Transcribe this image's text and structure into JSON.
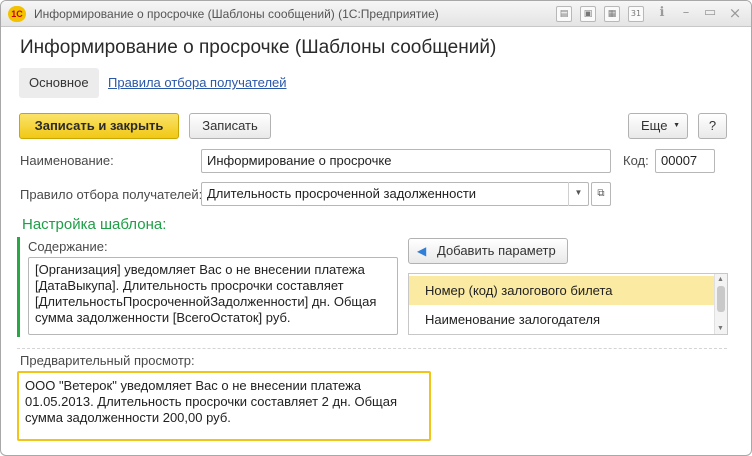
{
  "window": {
    "title": "Информирование о просрочке (Шаблоны сообщений)  (1С:Предприятие)",
    "logo": "1С",
    "icons": [
      "print-icon",
      "save-icon",
      "calendar-icon",
      "calendar31-icon",
      "text-icon",
      "minimize-icon",
      "maximize-icon",
      "close-icon"
    ],
    "calendar_day": "31"
  },
  "form": {
    "title": "Информирование о просрочке (Шаблоны сообщений)",
    "tabs": [
      {
        "label": "Основное"
      },
      {
        "label": "Правила отбора получателей"
      }
    ]
  },
  "toolbar": {
    "save_close_label": "Записать и закрыть",
    "save_label": "Записать",
    "more_label": "Еще",
    "help_label": "?"
  },
  "fields": {
    "name_label": "Наименование:",
    "name_value": "Информирование о просрочке",
    "code_label": "Код:",
    "code_value": "00007",
    "rule_label": "Правило отбора получателей:",
    "rule_value": "Длительность просроченной задолженности"
  },
  "template": {
    "section_title": "Настройка шаблона:",
    "content_label": "Содержание:",
    "content_lines": [
      "[Организация] уведомляет Вас о не внесении платежа",
      "[ДатаВыкупа]. Длительность просрочки составляет",
      "[ДлительностьПросроченнойЗадолженности] дн. Общая",
      "сумма задолженности [ВсегоОстаток] руб."
    ],
    "add_param_label": "Добавить параметр",
    "params": [
      {
        "label": "Номер (код) залогового билета",
        "selected": true
      },
      {
        "label": "Наименование залогодателя",
        "selected": false
      }
    ]
  },
  "preview": {
    "label": "Предварительный просмотр:",
    "lines": [
      "ООО \"Ветерок\" уведомляет Вас о не внесении платежа",
      "01.05.2013. Длительность просрочки составляет 2 дн. Общая",
      "сумма задолженности 200,00 руб."
    ]
  },
  "colors": {
    "accent_yellow": "#f1c813",
    "section_green": "#1e9e46",
    "link_blue": "#2b57a8",
    "selected_row": "#fbeaa2"
  }
}
